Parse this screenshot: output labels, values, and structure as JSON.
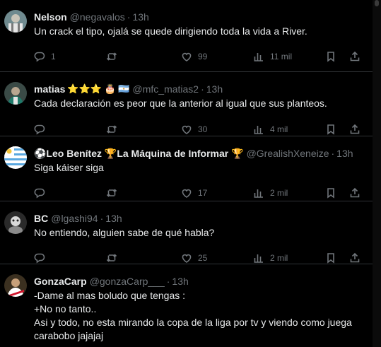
{
  "tweets": [
    {
      "name": "Nelson",
      "badges": "",
      "handle": "@negavalos",
      "time": "13h",
      "text": [
        "Un crack el tipo, ojalá se quede dirigiendo toda la vida a River."
      ],
      "replies": "1",
      "retweets": "",
      "likes": "99",
      "views": "11 mil"
    },
    {
      "name": "matias",
      "badges": "⭐⭐⭐ 🎂 🇦🇷",
      "handle": "@mfc_matias2",
      "time": "13h",
      "text": [
        "Cada declaración es peor que la anterior al igual que sus planteos."
      ],
      "replies": "",
      "retweets": "",
      "likes": "30",
      "views": "4 mil"
    },
    {
      "name": "⚽Leo Benítez 🏆La Máquina de Informar 🏆",
      "badges": "",
      "handle": "@GrealishXeneize",
      "time": "13h",
      "text": [
        "Siga káiser siga"
      ],
      "replies": "",
      "retweets": "",
      "likes": "17",
      "views": "2 mil"
    },
    {
      "name": "BC",
      "badges": "",
      "handle": "@lgashi94",
      "time": "13h",
      "text": [
        "No entiendo, alguien sabe de qué habla?"
      ],
      "replies": "",
      "retweets": "",
      "likes": "25",
      "views": "2 mil"
    },
    {
      "name": "GonzaCarp",
      "badges": "",
      "handle": "@gonzaCarp___",
      "time": "13h",
      "text": [
        "-Dame al mas boludo que tengas :",
        "+No no tanto..",
        "Asi y todo, no esta mirando la copa de la liga por tv y viendo como juega",
        "carabobo jajajaj"
      ],
      "replies": "",
      "retweets": "",
      "likes": "",
      "views": ""
    }
  ],
  "icons": {
    "reply": "reply-icon",
    "retweet": "retweet-icon",
    "like": "heart-icon",
    "views": "views-icon",
    "bookmark": "bookmark-icon",
    "share": "share-icon"
  }
}
